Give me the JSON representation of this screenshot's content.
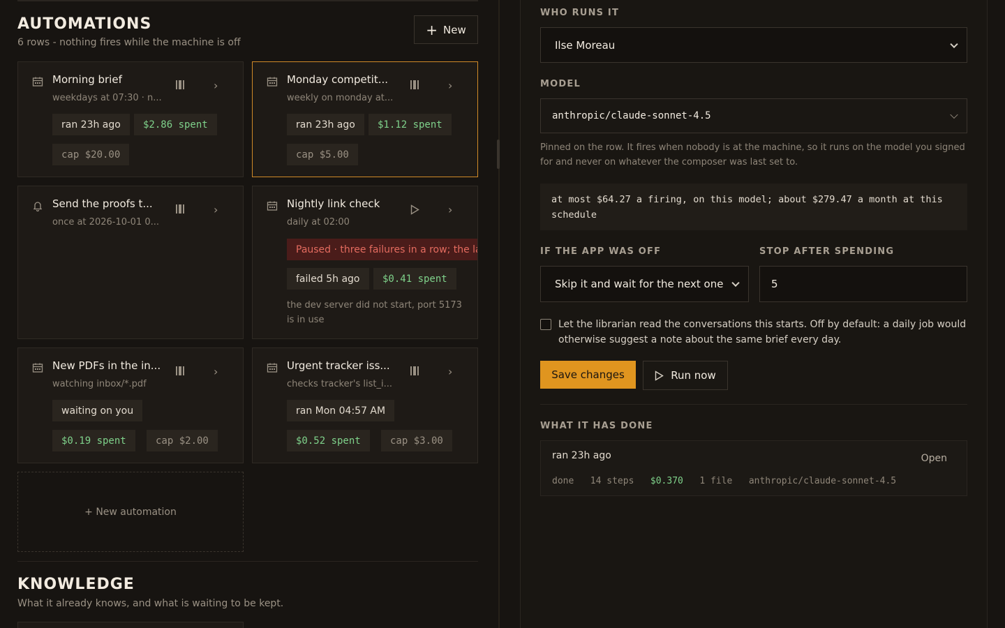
{
  "automations": {
    "title": "AUTOMATIONS",
    "subtitle": "6 rows - nothing fires while the machine is off",
    "new_label": "New",
    "new_automation_label": "+ New automation",
    "cards": [
      {
        "title": "Morning brief",
        "schedule": "weekdays at 07:30 · n...",
        "icon": "calendar-icon",
        "action": "pause",
        "chips": [
          "ran 23h ago",
          "$2.86 spent",
          "cap $20.00"
        ]
      },
      {
        "title": "Monday competit...",
        "schedule": "weekly on monday at...",
        "icon": "calendar-icon",
        "action": "pause",
        "chips": [
          "ran 23h ago",
          "$1.12 spent",
          "cap $5.00"
        ],
        "selected": true
      },
      {
        "title": "Send the proofs t...",
        "schedule": "once at 2026-10-01 0...",
        "icon": "bell-icon",
        "action": "pause",
        "chips": []
      },
      {
        "title": "Nightly link check",
        "schedule": "daily at 02:00",
        "icon": "calendar-icon",
        "action": "play",
        "error": "Paused · three failures in a row; the last",
        "chips": [
          "failed 5h ago",
          "$0.41 spent"
        ],
        "note": "the dev server did not start, port 5173 is in use"
      },
      {
        "title": "New PDFs in the in...",
        "schedule": "watching inbox/*.pdf",
        "icon": "calendar-icon",
        "action": "pause",
        "chips": [
          "waiting on you",
          "$0.19 spent",
          "cap $2.00"
        ]
      },
      {
        "title": "Urgent tracker iss...",
        "schedule": "checks tracker's list_i...",
        "icon": "calendar-icon",
        "action": "pause",
        "chips": [
          "ran Mon 04:57 AM",
          "$0.52 spent",
          "cap $3.00"
        ]
      }
    ]
  },
  "knowledge": {
    "title": "KNOWLEDGE",
    "subtitle": "What it already knows, and what is waiting to be kept."
  },
  "detail": {
    "who_label": "WHO RUNS IT",
    "who_value": "Ilse Moreau",
    "model_label": "MODEL",
    "model_value": "anthropic/claude-sonnet-4.5",
    "model_help": "Pinned on the row. It fires when nobody is at the machine, so it runs on the model you signed for and never on whatever the composer was last set to.",
    "estimate": "at most $64.27 a firing, on this model; about $279.47 a month at this schedule",
    "off_label": "IF THE APP WAS OFF",
    "off_value": "Skip it and wait for the next one",
    "stop_label": "STOP AFTER SPENDING",
    "stop_value": "5",
    "librarian_label": "Let the librarian read the conversations this starts. Off by default: a daily job would otherwise suggest a note about the same brief every day.",
    "save_label": "Save changes",
    "run_label": "Run now",
    "history_label": "WHAT IT HAS DONE",
    "history": {
      "title": "ran 23h ago",
      "open_label": "Open",
      "status": "done",
      "steps": "14 steps",
      "cost": "$0.370",
      "files": "1 file",
      "model": "anthropic/claude-sonnet-4.5"
    }
  },
  "colors": {
    "accent": "#e0951f",
    "money": "#7fd28b",
    "error": "#e36b5f"
  }
}
